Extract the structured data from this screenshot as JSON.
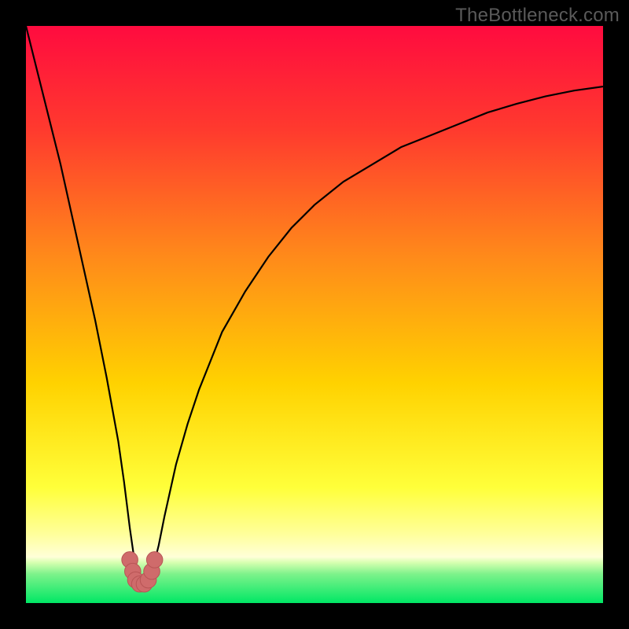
{
  "watermark": "TheBottleneck.com",
  "colors": {
    "frame": "#000000",
    "gradient_top": "#ff0b3f",
    "gradient_mid1": "#ff6e1f",
    "gradient_mid2": "#ffd200",
    "gradient_low": "#ffff66",
    "gradient_band_pale": "#ffffb0",
    "gradient_green": "#00e765",
    "curve": "#000000",
    "marker_fill": "#cf6b6b",
    "marker_stroke": "#b85555"
  },
  "chart_data": {
    "type": "line",
    "title": "",
    "xlabel": "",
    "ylabel": "",
    "xlim": [
      0,
      100
    ],
    "ylim": [
      0,
      100
    ],
    "note": "Axis values are normalized percentages of the plot area; the source image has no numeric tick labels. Curve is a V-shaped bottleneck profile with minimum near x≈20.",
    "series": [
      {
        "name": "bottleneck-curve",
        "x": [
          0,
          2,
          4,
          6,
          8,
          10,
          12,
          14,
          16,
          17,
          18,
          19,
          20,
          21,
          22,
          23,
          24,
          26,
          28,
          30,
          34,
          38,
          42,
          46,
          50,
          55,
          60,
          65,
          70,
          75,
          80,
          85,
          90,
          95,
          100
        ],
        "y": [
          100,
          92,
          84,
          76,
          67,
          58,
          49,
          39,
          28,
          21,
          13,
          6,
          3,
          3,
          6,
          10,
          15,
          24,
          31,
          37,
          47,
          54,
          60,
          65,
          69,
          73,
          76,
          79,
          81,
          83,
          85,
          86.5,
          87.8,
          88.8,
          89.5
        ]
      }
    ],
    "markers": {
      "name": "highlighted-range",
      "points": [
        {
          "x": 18.0,
          "y": 7.5,
          "r": 1.4
        },
        {
          "x": 18.5,
          "y": 5.5,
          "r": 1.4
        },
        {
          "x": 19.0,
          "y": 4.0,
          "r": 1.4
        },
        {
          "x": 19.7,
          "y": 3.3,
          "r": 1.4
        },
        {
          "x": 20.5,
          "y": 3.3,
          "r": 1.4
        },
        {
          "x": 21.2,
          "y": 4.0,
          "r": 1.4
        },
        {
          "x": 21.8,
          "y": 5.5,
          "r": 1.4
        },
        {
          "x": 22.3,
          "y": 7.5,
          "r": 1.4
        }
      ]
    },
    "gradient_stops_vertical_pct": [
      {
        "offset": 0,
        "color": "#ff0b3f"
      },
      {
        "offset": 18,
        "color": "#ff3a2e"
      },
      {
        "offset": 40,
        "color": "#ff8a1a"
      },
      {
        "offset": 62,
        "color": "#ffd200"
      },
      {
        "offset": 80,
        "color": "#ffff3a"
      },
      {
        "offset": 88,
        "color": "#ffff9a"
      },
      {
        "offset": 92,
        "color": "#ffffd8"
      },
      {
        "offset": 93,
        "color": "#d6ffb0"
      },
      {
        "offset": 95,
        "color": "#7cf28a"
      },
      {
        "offset": 100,
        "color": "#00e765"
      }
    ]
  }
}
